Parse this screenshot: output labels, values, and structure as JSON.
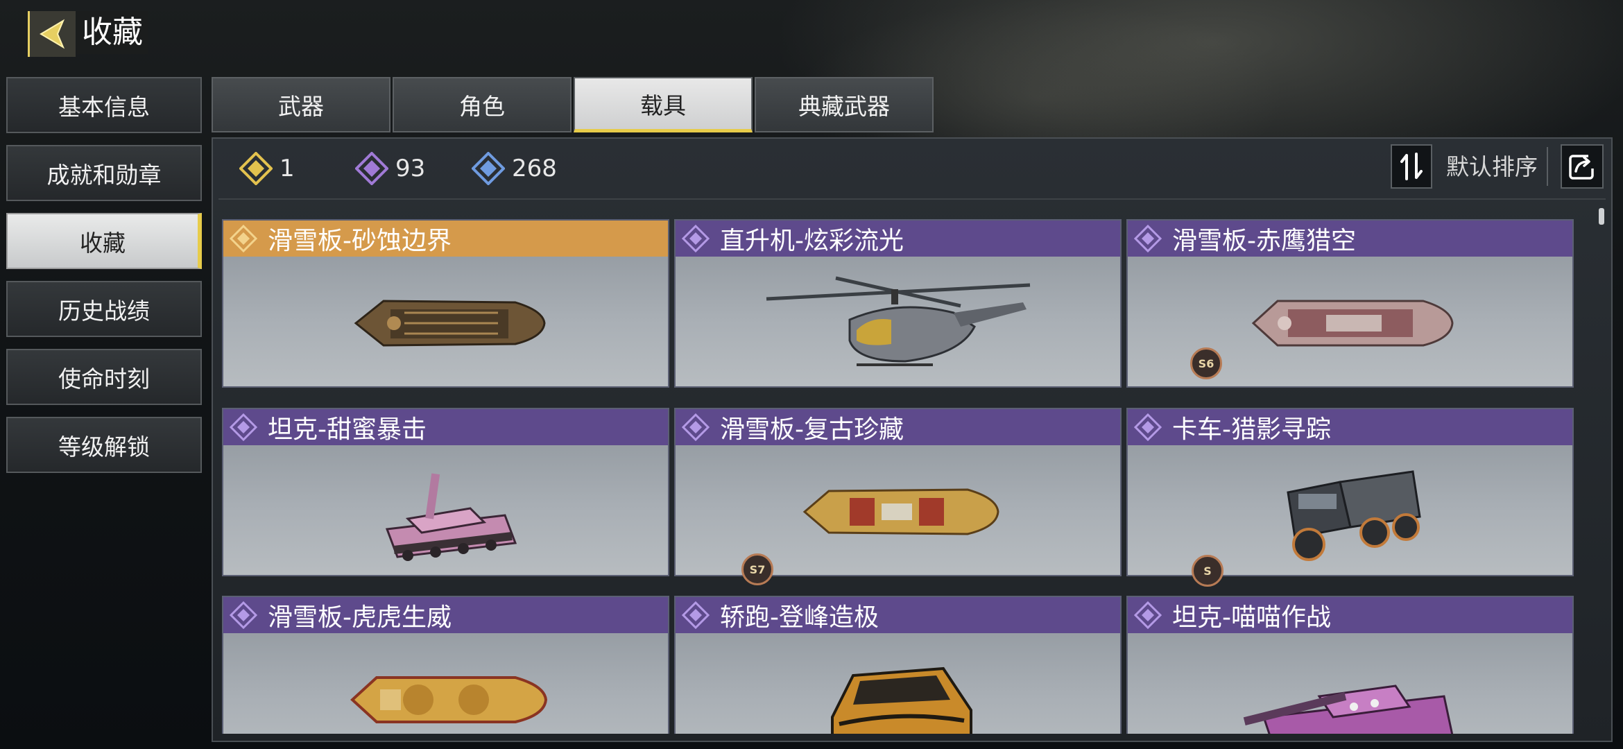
{
  "header": {
    "title": "收藏",
    "back_icon": "back-arrow-icon"
  },
  "sidebar": {
    "items": [
      {
        "label": "基本信息",
        "active": false
      },
      {
        "label": "成就和勋章",
        "active": false
      },
      {
        "label": "收藏",
        "active": true
      },
      {
        "label": "历史战绩",
        "active": false
      },
      {
        "label": "使命时刻",
        "active": false
      },
      {
        "label": "等级解锁",
        "active": false
      }
    ]
  },
  "tabs": [
    {
      "label": "武器",
      "active": false
    },
    {
      "label": "角色",
      "active": false
    },
    {
      "label": "载具",
      "active": true
    },
    {
      "label": "典藏武器",
      "active": false
    }
  ],
  "counters": [
    {
      "tier": "legendary",
      "color": "#e3c24e",
      "count": "1"
    },
    {
      "tier": "epic",
      "color": "#a07ad6",
      "count": "93"
    },
    {
      "tier": "rare",
      "color": "#6f9be0",
      "count": "268"
    }
  ],
  "toolbar": {
    "sort_label": "默认排序",
    "sort_icon": "sort-icon",
    "share_icon": "share-icon"
  },
  "cards": [
    {
      "title": "滑雪板-砂蚀边界",
      "rarity": "legendary",
      "vehicle": "hoverboard",
      "scheme": "bronze",
      "badge": ""
    },
    {
      "title": "直升机-炫彩流光",
      "rarity": "epic",
      "vehicle": "helicopter",
      "scheme": "gold",
      "badge": ""
    },
    {
      "title": "滑雪板-赤鹰猎空",
      "rarity": "epic",
      "vehicle": "hoverboard",
      "scheme": "pink",
      "badge": "S6"
    },
    {
      "title": "坦克-甜蜜暴击",
      "rarity": "epic",
      "vehicle": "tank",
      "scheme": "pink",
      "badge": ""
    },
    {
      "title": "滑雪板-复古珍藏",
      "rarity": "epic",
      "vehicle": "hoverboard",
      "scheme": "gold",
      "badge": "S7"
    },
    {
      "title": "卡车-猎影寻踪",
      "rarity": "epic",
      "vehicle": "truck",
      "scheme": "dark",
      "badge": "S"
    },
    {
      "title": "滑雪板-虎虎生威",
      "rarity": "epic",
      "vehicle": "hoverboard",
      "scheme": "gold",
      "badge": ""
    },
    {
      "title": "轿跑-登峰造极",
      "rarity": "epic",
      "vehicle": "car",
      "scheme": "gold",
      "badge": ""
    },
    {
      "title": "坦克-喵喵作战",
      "rarity": "epic",
      "vehicle": "tank",
      "scheme": "magenta",
      "badge": ""
    }
  ]
}
